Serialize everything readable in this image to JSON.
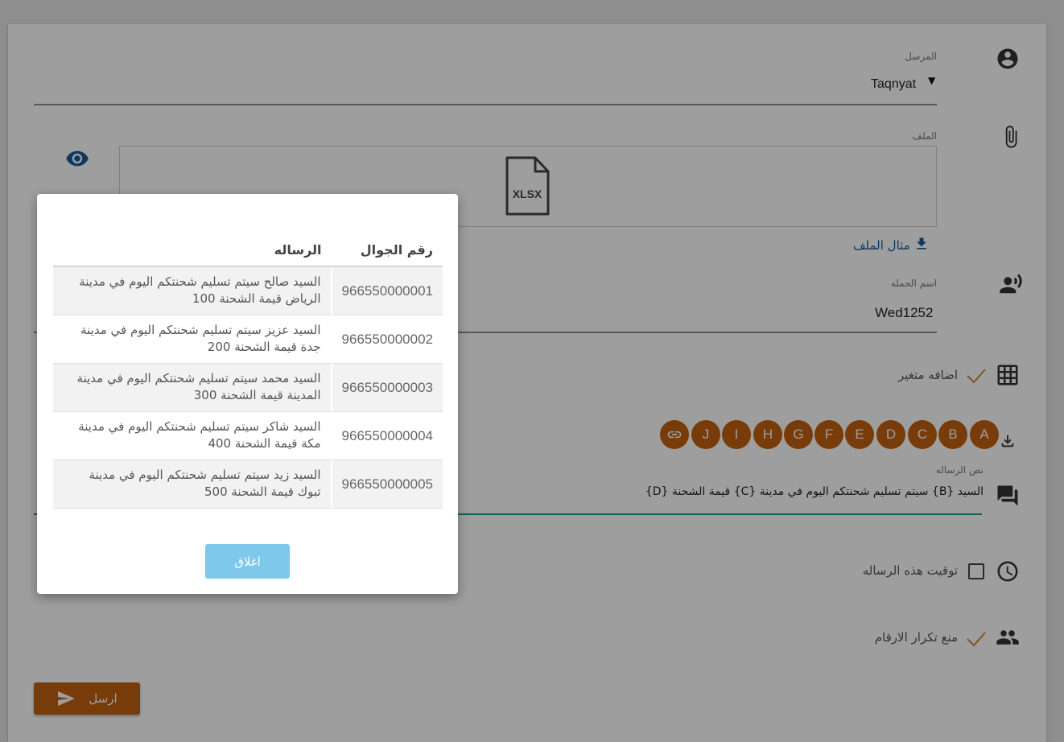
{
  "sender": {
    "label": "المرسل",
    "value": "Taqnyat"
  },
  "file": {
    "label": "الملف",
    "file_type": "XLSX",
    "example_link": "مثال الملف"
  },
  "campaign": {
    "label": "اسم الحمله",
    "value": "Wed1252"
  },
  "add_variable": {
    "label": "اضافه متغير"
  },
  "variables": [
    "A",
    "B",
    "C",
    "D",
    "E",
    "F",
    "G",
    "H",
    "I",
    "J"
  ],
  "message": {
    "label": "نص الرساله",
    "value": "السيد {B} سيتم تسليم شحنتكم اليوم في مدينة {C} قيمة الشحنة {D}"
  },
  "schedule": {
    "label": "توقيت هذه الرساله"
  },
  "dedupe": {
    "label": "منع تكرار الارقام"
  },
  "send_button": {
    "label": "ارسل"
  },
  "modal": {
    "headers": {
      "phone": "رقم الجوال",
      "message": "الرساله"
    },
    "rows": [
      {
        "phone": "966550000001",
        "message": "السيد صالح سيتم تسليم شحنتكم اليوم في مدينة الرياض قيمة الشحنة 100"
      },
      {
        "phone": "966550000002",
        "message": "السيد عزيز سيتم تسليم شحنتكم اليوم في مدينة جدة قيمة الشحنة 200"
      },
      {
        "phone": "966550000003",
        "message": "السيد محمد سيتم تسليم شحنتكم اليوم في مدينة المدينة قيمة الشحنة 300"
      },
      {
        "phone": "966550000004",
        "message": "السيد شاكر سيتم تسليم شحنتكم اليوم في مدينة مكة قيمة الشحنة 400"
      },
      {
        "phone": "966550000005",
        "message": "السيد زيد سيتم تسليم شحنتكم اليوم في مدينة تبوك قيمة الشحنة 500"
      }
    ],
    "close_label": "اغلاق"
  },
  "colors": {
    "accent": "#c0610f",
    "close_button": "#7ec8ec",
    "link": "#1a5a9a",
    "message_underline": "#1a9a8a"
  },
  "icons": [
    "account-circle-icon",
    "paperclip-icon",
    "eye-icon",
    "xlsx-file-icon",
    "download-icon",
    "record-voice-icon",
    "grid-icon",
    "check-icon",
    "link-icon",
    "chat-icon",
    "clock-icon",
    "people-icon",
    "send-icon"
  ]
}
